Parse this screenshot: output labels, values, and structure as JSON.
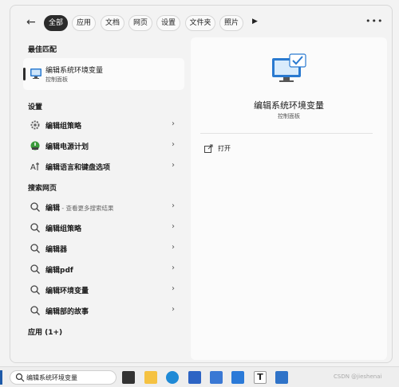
{
  "filters": {
    "tabs": [
      "全部",
      "应用",
      "文档",
      "网页",
      "设置",
      "文件夹",
      "照片"
    ],
    "more_label": "•••"
  },
  "best_match": {
    "heading": "最佳匹配",
    "title": "编辑系统环境变量",
    "subtitle": "控制面板"
  },
  "settings": {
    "heading": "设置",
    "items": [
      {
        "label": "编辑组策略",
        "icon": "gear-icon"
      },
      {
        "label": "编辑电源计划",
        "icon": "power-plan-icon"
      },
      {
        "label": "编辑语言和键盘选项",
        "icon": "language-icon"
      }
    ]
  },
  "web": {
    "heading": "搜索网页",
    "items": [
      {
        "label": "编辑",
        "suffix": " - 查看更多搜索结果"
      },
      {
        "label": "编辑组策略",
        "suffix": ""
      },
      {
        "label": "编辑器",
        "suffix": ""
      },
      {
        "label": "编辑pdf",
        "suffix": ""
      },
      {
        "label": "编辑环境变量",
        "suffix": ""
      },
      {
        "label": "编辑部的故事",
        "suffix": ""
      }
    ]
  },
  "apps": {
    "heading": "应用 (1+)"
  },
  "detail": {
    "title": "编辑系统环境变量",
    "subtitle": "控制面板",
    "open_label": "打开"
  },
  "taskbar": {
    "search_value": "编辑系统环境变量",
    "watermark": "CSDN @jieshenai"
  }
}
